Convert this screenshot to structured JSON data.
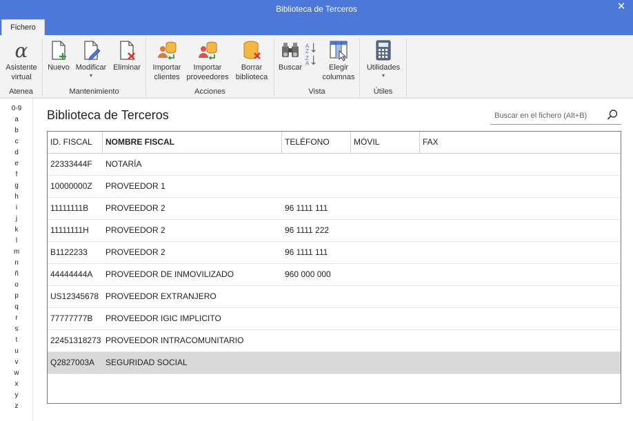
{
  "window": {
    "title": "Biblioteca de Terceros",
    "close_glyph": "✕"
  },
  "tabs": [
    {
      "label": "Fichero"
    }
  ],
  "ribbon": {
    "groups": [
      {
        "label": "Atenea",
        "buttons": [
          {
            "line1": "Asistente",
            "line2": "virtual",
            "icon": "alpha-icon"
          }
        ]
      },
      {
        "label": "Mantenimiento",
        "buttons": [
          {
            "line1": "Nuevo",
            "line2": "",
            "icon": "new-document-icon"
          },
          {
            "line1": "Modificar",
            "line2": "",
            "icon": "edit-document-icon",
            "has_dropdown": true
          },
          {
            "line1": "Eliminar",
            "line2": "",
            "icon": "delete-document-icon"
          }
        ]
      },
      {
        "label": "Acciones",
        "buttons": [
          {
            "line1": "Importar",
            "line2": "clientes",
            "icon": "import-clients-icon"
          },
          {
            "line1": "Importar",
            "line2": "proveedores",
            "icon": "import-suppliers-icon"
          },
          {
            "line1": "Borrar",
            "line2": "biblioteca",
            "icon": "delete-library-icon"
          }
        ]
      },
      {
        "label": "Vista",
        "buttons": [
          {
            "line1": "Buscar",
            "line2": "",
            "icon": "binoculars-icon"
          },
          {
            "line1": "",
            "line2": "",
            "icon": "sort-az-icon"
          },
          {
            "line1": "Elegir",
            "line2": "columnas",
            "icon": "choose-columns-icon"
          }
        ]
      },
      {
        "label": "Útiles",
        "buttons": [
          {
            "line1": "Utilidades",
            "line2": "",
            "icon": "calculator-icon",
            "has_dropdown": true
          }
        ]
      }
    ],
    "caret": "▾"
  },
  "alphabet": [
    "0-9",
    "a",
    "b",
    "c",
    "d",
    "e",
    "f",
    "g",
    "h",
    "i",
    "j",
    "k",
    "l",
    "m",
    "n",
    "ñ",
    "o",
    "p",
    "q",
    "r",
    "s",
    "t",
    "u",
    "v",
    "w",
    "x",
    "y",
    "z"
  ],
  "main": {
    "title": "Biblioteca de Terceros",
    "search": {
      "placeholder": "Buscar en el fichero (Alt+B)",
      "value": ""
    }
  },
  "table": {
    "columns": [
      "ID. FISCAL",
      "NOMBRE FISCAL",
      "TELÉFONO",
      "MÓVIL",
      "FAX"
    ],
    "sorted_column": "NOMBRE FISCAL",
    "rows": [
      {
        "id": "22333444F",
        "nombre": "NOTARÍA",
        "telefono": "",
        "movil": "",
        "fax": ""
      },
      {
        "id": "10000000Z",
        "nombre": "PROVEEDOR 1",
        "telefono": "",
        "movil": "",
        "fax": ""
      },
      {
        "id": "11111111B",
        "nombre": "PROVEEDOR 2",
        "telefono": "96 1111 111",
        "movil": "",
        "fax": ""
      },
      {
        "id": "11111111H",
        "nombre": "PROVEEDOR 2",
        "telefono": "96 1111 222",
        "movil": "",
        "fax": ""
      },
      {
        "id": "B1122233",
        "nombre": "PROVEEDOR 2",
        "telefono": "96 1111 111",
        "movil": "",
        "fax": ""
      },
      {
        "id": "44444444A",
        "nombre": "PROVEEDOR DE INMOVILIZADO",
        "telefono": "960 000 000",
        "movil": "",
        "fax": ""
      },
      {
        "id": "US12345678",
        "nombre": "PROVEEDOR EXTRANJERO",
        "telefono": "",
        "movil": "",
        "fax": ""
      },
      {
        "id": "77777777B",
        "nombre": "PROVEEDOR IGIC IMPLICITO",
        "telefono": "",
        "movil": "",
        "fax": ""
      },
      {
        "id": "22451318273",
        "nombre": "PROVEEDOR INTRACOMUNITARIO",
        "telefono": "",
        "movil": "",
        "fax": ""
      },
      {
        "id": "Q2827003A",
        "nombre": "SEGURIDAD SOCIAL",
        "telefono": "",
        "movil": "",
        "fax": "",
        "selected": true
      }
    ]
  },
  "colors": {
    "titlebar": "#4b78d9",
    "ribbon": "#f3f3f3",
    "selected_row": "#d9d9d9",
    "accent_orange": "#f5a623",
    "accent_red": "#e0302a",
    "accent_green": "#2a9d3a"
  }
}
